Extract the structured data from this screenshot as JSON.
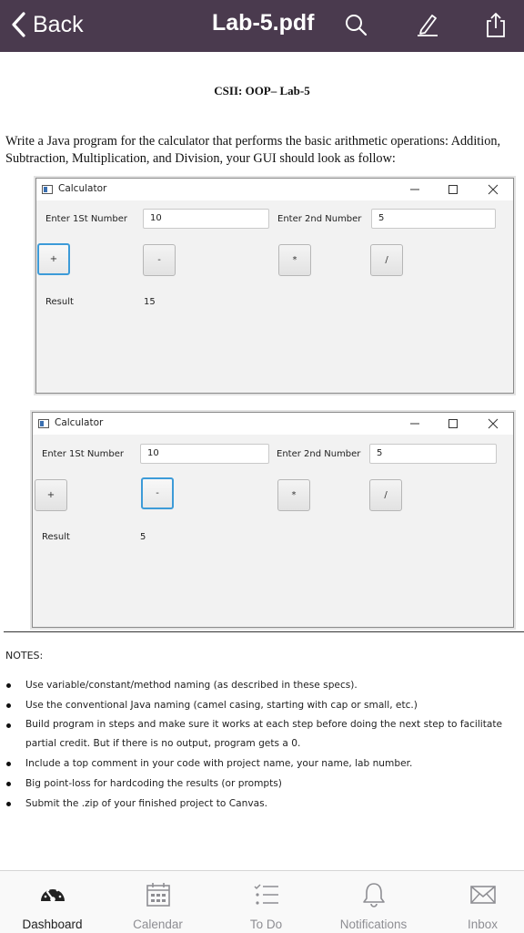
{
  "header": {
    "back_label": "Back",
    "title": "Lab-5.pdf",
    "icons": [
      "search-icon",
      "annotate-pen-icon",
      "share-icon"
    ],
    "color": "#4a3a4e"
  },
  "document": {
    "heading": "CSII: OOP– Lab-5",
    "intro": "Write a Java program for the calculator that performs the basic arithmetic operations: Addition, Subtraction, Multiplication, and Division, your GUI should look as follow:",
    "windows": [
      {
        "title": "Calculator",
        "label1": "Enter 1St Number",
        "value1": "10",
        "label2": "Enter 2nd Number",
        "value2": "5",
        "buttons": [
          "+",
          "-",
          "*",
          "/"
        ],
        "focused": "+",
        "result_label": "Result",
        "result_value": "15"
      },
      {
        "title": "Calculator",
        "label1": "Enter 1St Number",
        "value1": "10",
        "label2": "Enter 2nd Number",
        "value2": "5",
        "buttons": [
          "+",
          "-",
          "*",
          "/"
        ],
        "focused": "-",
        "result_label": "Result",
        "result_value": "5"
      }
    ],
    "notes_title": "NOTES:",
    "notes": [
      "Use variable/constant/method naming (as described in these specs).",
      "Use the conventional Java naming (camel casing, starting with cap or small, etc.)",
      "Build program in steps and make sure it works at each step before doing the next step to facilitate partial credit. But if there is no output, program gets a 0.",
      "Include a top comment in your code with project name, your name, lab number.",
      "Big point-loss for hardcoding the results (or prompts)",
      "Submit the .zip of your finished project to Canvas."
    ]
  },
  "tabbar": {
    "tabs": [
      {
        "label": "Dashboard",
        "icon": "dashboard-speedometer-icon",
        "active": true
      },
      {
        "label": "Calendar",
        "icon": "calendar-icon",
        "active": false
      },
      {
        "label": "To Do",
        "icon": "todo-list-icon",
        "active": false
      },
      {
        "label": "Notifications",
        "icon": "bell-icon",
        "active": false
      },
      {
        "label": "Inbox",
        "icon": "envelope-icon",
        "active": false
      }
    ]
  }
}
